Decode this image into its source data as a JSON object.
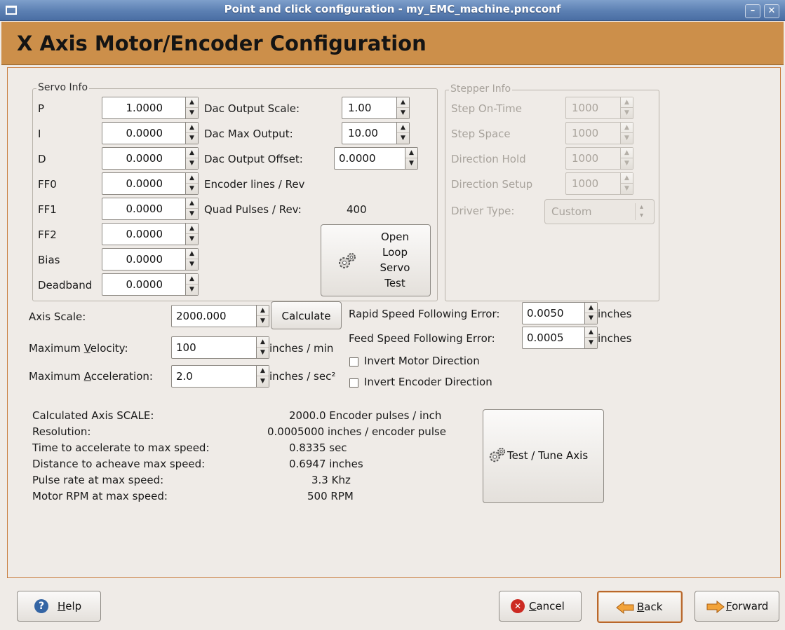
{
  "window": {
    "title": "Point and click configuration - my_EMC_machine.pncconf"
  },
  "header": {
    "title": "X Axis Motor/Encoder Configuration"
  },
  "servo_info": {
    "legend": "Servo Info",
    "params": [
      {
        "label": "P",
        "value": "1.0000"
      },
      {
        "label": "I",
        "value": "0.0000"
      },
      {
        "label": "D",
        "value": "0.0000"
      },
      {
        "label": "FF0",
        "value": "0.0000"
      },
      {
        "label": "FF1",
        "value": "0.0000"
      },
      {
        "label": "FF2",
        "value": "0.0000"
      },
      {
        "label": "Bias",
        "value": "0.0000"
      },
      {
        "label": "Deadband",
        "value": "0.0000"
      }
    ],
    "dac_scale_label": "Dac Output Scale:",
    "dac_scale_value": "1.00",
    "dac_max_label": "Dac Max Output:",
    "dac_max_value": "10.00",
    "dac_offset_label": "Dac Output Offset:",
    "dac_offset_value": "0.0000",
    "encoder_lines_label": "Encoder lines / Rev",
    "quad_pulses_label": "Quad Pulses / Rev:",
    "quad_pulses_value": "400",
    "open_loop_button": [
      "Open",
      "Loop",
      "Servo",
      "Test"
    ]
  },
  "stepper_info": {
    "legend": "Stepper Info",
    "step_on_time_label": "Step On-Time",
    "step_on_time_value": "1000",
    "step_space_label": "Step Space",
    "step_space_value": "1000",
    "direction_hold_label": "Direction Hold",
    "direction_hold_value": "1000",
    "direction_setup_label": "Direction Setup",
    "direction_setup_value": "1000",
    "driver_type_label": "Driver Type:",
    "driver_type_value": "Custom"
  },
  "axis": {
    "scale_label": "Axis Scale:",
    "scale_value": "2000.000",
    "calculate_button": "Calculate",
    "max_velocity_label_pre": "Maximum ",
    "max_velocity_label_mn": "V",
    "max_velocity_label_post": "elocity:",
    "max_velocity_value": "100",
    "max_velocity_unit": "inches / min",
    "max_accel_label_pre": "Maximum ",
    "max_accel_label_mn": "A",
    "max_accel_label_post": "cceleration:",
    "max_accel_value": "2.0",
    "max_accel_unit": "inches / sec²",
    "rapid_ferror_label": "Rapid Speed Following Error:",
    "rapid_ferror_value": "0.0050",
    "rapid_ferror_unit": "inches",
    "feed_ferror_label": "Feed Speed Following Error:",
    "feed_ferror_value": "0.0005",
    "feed_ferror_unit": "inches",
    "invert_motor_label": "Invert Motor Direction",
    "invert_encoder_label": "Invert Encoder Direction"
  },
  "calc": {
    "rows": [
      {
        "label": "Calculated Axis SCALE:",
        "value": "2000.0 Encoder pulses / inch"
      },
      {
        "label": "Resolution:",
        "value": "0.0005000 inches / encoder pulse"
      },
      {
        "label": "Time to accelerate to max speed:",
        "value": "0.8335 sec"
      },
      {
        "label": "Distance to acheave max speed:",
        "value": "0.6947 inches"
      },
      {
        "label": "Pulse rate at max speed:",
        "value": "3.3 Khz"
      },
      {
        "label": "Motor RPM at max speed:",
        "value": "500 RPM"
      }
    ],
    "test_tune_button": "Test / Tune Axis"
  },
  "footer": {
    "help_pre": "",
    "help_mn": "H",
    "help_post": "elp",
    "cancel_mn": "C",
    "cancel_post": "ancel",
    "back_mn": "B",
    "back_post": "ack",
    "forward_mn": "F",
    "forward_post": "orward"
  },
  "colors": {
    "header_bg": "#cc8f4a",
    "titlebar": "#5b7fb2",
    "window_bg": "#efebe7"
  },
  "icons": [
    "window-menu-icon",
    "minimize-icon",
    "close-icon",
    "gears-icon",
    "help-icon",
    "cancel-icon",
    "back-arrow-icon",
    "forward-arrow-icon"
  ]
}
